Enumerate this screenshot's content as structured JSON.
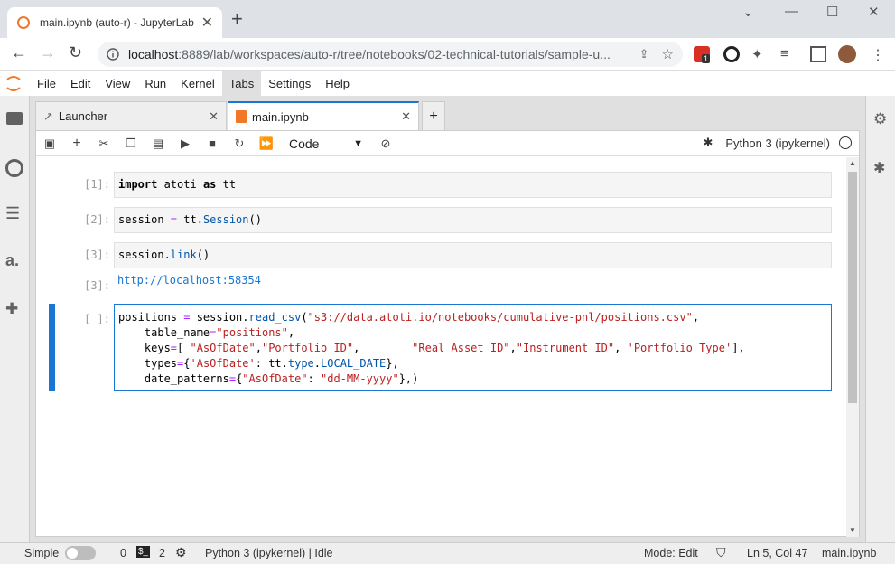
{
  "browser": {
    "tab_title": "main.ipynb (auto-r) - JupyterLab",
    "url_host": "localhost",
    "url_rest": ":8889/lab/workspaces/auto-r/tree/notebooks/02-technical-tutorials/sample-u...",
    "extension_badge": "1"
  },
  "menubar": {
    "items": [
      "File",
      "Edit",
      "View",
      "Run",
      "Kernel",
      "Tabs",
      "Settings",
      "Help"
    ]
  },
  "dock": {
    "tab_launcher": "Launcher",
    "tab_main": "main.ipynb"
  },
  "toolbar": {
    "cell_type": "Code",
    "kernel_name": "Python 3 (ipykernel)"
  },
  "cells": {
    "c1": {
      "prompt": "[1]:"
    },
    "c2": {
      "prompt": "[2]:"
    },
    "c3": {
      "prompt": "[3]:",
      "out_prompt": "[3]:",
      "output": "http://localhost:58354"
    },
    "c4": {
      "prompt": "[ ]:"
    }
  },
  "status": {
    "mode_label": "Simple",
    "terminals": "0",
    "kernels": "2",
    "kernel_status": "Python 3 (ipykernel) | Idle",
    "mode": "Mode: Edit",
    "position": "Ln 5, Col 47",
    "filename": "main.ipynb"
  },
  "colors": {
    "accent": "#1976d2",
    "string": "#ba2121",
    "keyword": "#000000"
  }
}
